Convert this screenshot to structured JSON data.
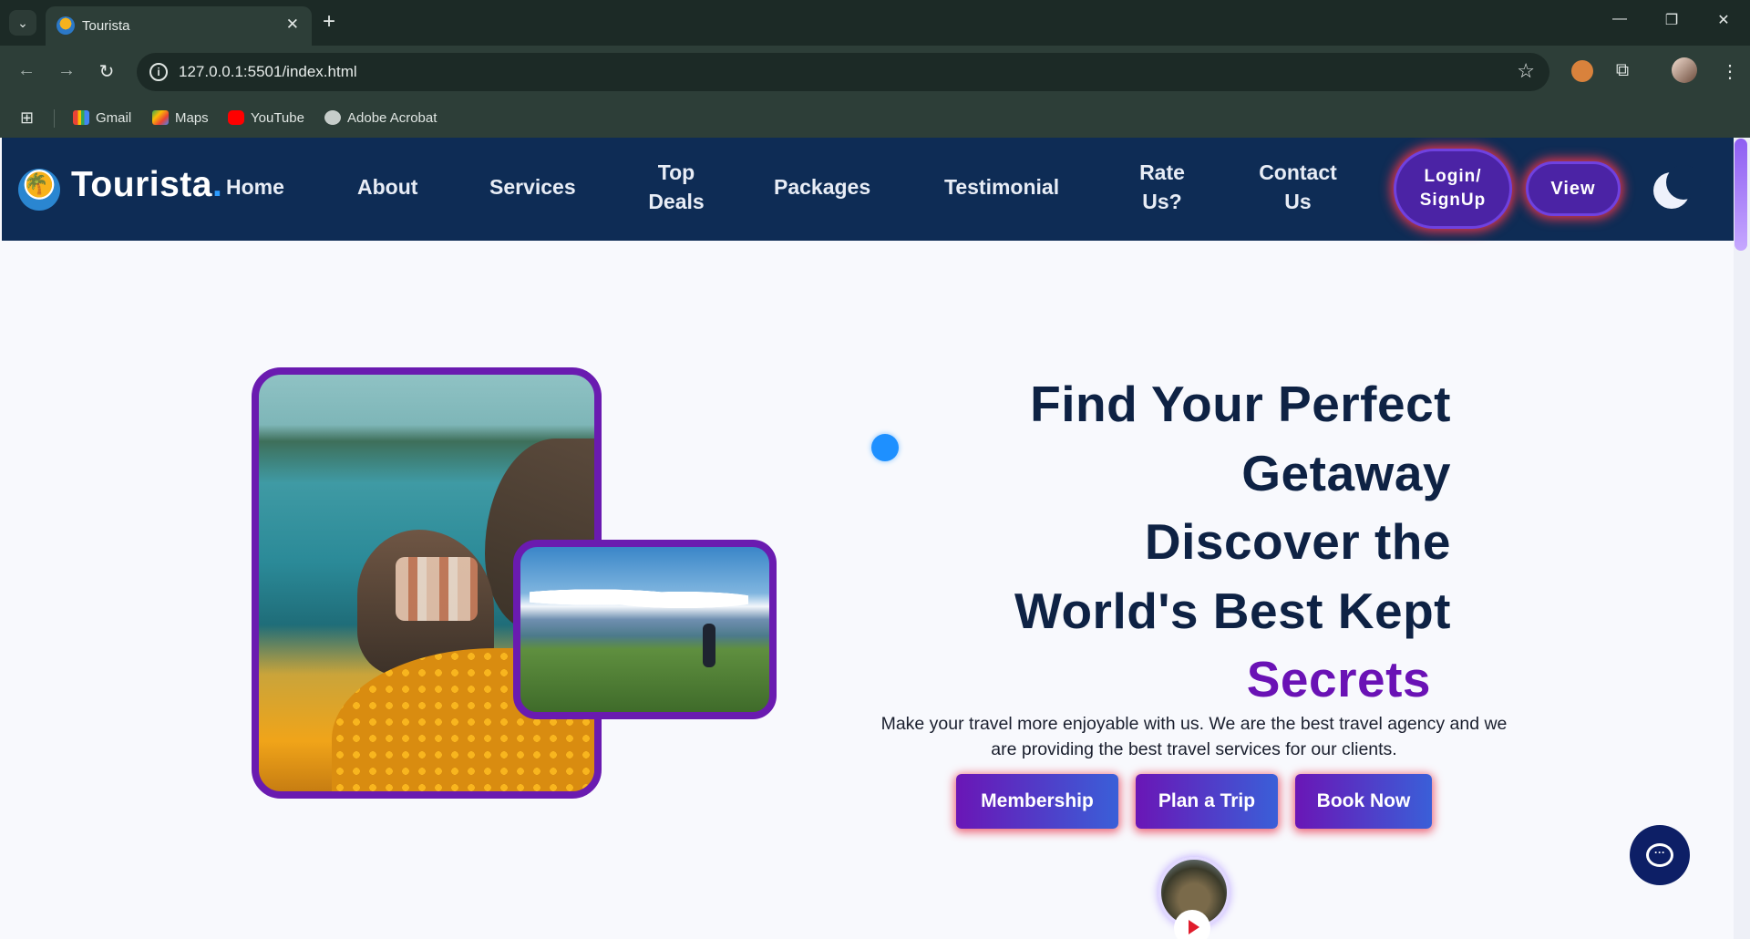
{
  "browser": {
    "tab_title": "Tourista",
    "url": "127.0.0.1:5501/index.html",
    "new_tab_symbol": "+",
    "close_symbol": "✕",
    "bookmarks": [
      "Gmail",
      "Maps",
      "YouTube",
      "Adobe Acrobat"
    ]
  },
  "site": {
    "brand": "Tourista",
    "brand_dot": ".",
    "nav": {
      "home": "Home",
      "about": "About",
      "services": "Services",
      "top_deals_1": "Top",
      "top_deals_2": "Deals",
      "packages": "Packages",
      "testimonial": "Testimonial",
      "rate_1": "Rate",
      "rate_2": "Us?",
      "contact_1": "Contact",
      "contact_2": "Us",
      "login_1": "Login/",
      "login_2": "SignUp",
      "view": "View"
    },
    "hero": {
      "line1": "Find Your Perfect",
      "line2": "Getaway",
      "line3": "Discover the",
      "line4": "World's Best Kept",
      "accent": "Secrets",
      "subtext": "Make your travel more enjoyable with us. We are the best travel agency and we are providing the best travel services for our clients.",
      "cta_membership": "Membership",
      "cta_plan": "Plan a Trip",
      "cta_book": "Book Now"
    }
  },
  "colors": {
    "nav_bg": "#0e2c55",
    "accent_purple": "#6a12b5",
    "heading": "#0e2244",
    "glow": "#e8364c",
    "chat_bg": "#0d1f66"
  },
  "icons": [
    "tab-list-icon",
    "favicon-icon",
    "close-icon",
    "plus-icon",
    "minimize-icon",
    "restore-icon",
    "back-icon",
    "forward-icon",
    "reload-icon",
    "site-info-icon",
    "star-icon",
    "cookie-extension-icon",
    "puzzle-icon",
    "profile-avatar",
    "more-icon",
    "apps-icon",
    "gmail-icon",
    "maps-icon",
    "youtube-icon",
    "globe-icon",
    "logo-icon",
    "moon-icon",
    "play-icon",
    "chat-icon"
  ]
}
